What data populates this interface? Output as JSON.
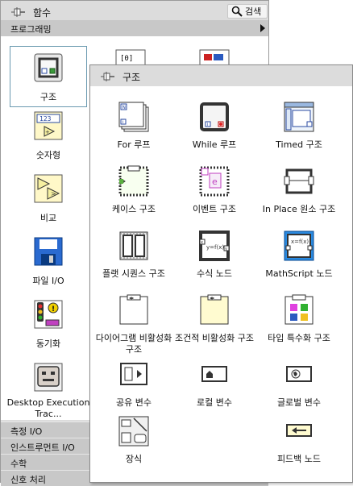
{
  "functions_palette": {
    "title": "함수",
    "search_label": "검색",
    "category_header": "프로그래밍",
    "items": [
      {
        "label": "구조",
        "icon": "structures-icon"
      },
      {
        "label": "숫자형",
        "icon": "numeric-icon"
      },
      {
        "label": "비교",
        "icon": "comparison-icon"
      },
      {
        "label": "파일 I/O",
        "icon": "file-io-icon"
      },
      {
        "label": "동기화",
        "icon": "synchronization-icon"
      },
      {
        "label": "Desktop Execution Trac...",
        "icon": "desktop-execution-trace-icon"
      }
    ],
    "categories": [
      "측정 I/O",
      "인스트루먼트 I/O",
      "수학",
      "신호 처리"
    ]
  },
  "structures_palette": {
    "title": "구조",
    "items": [
      {
        "label": "For 루프",
        "icon": "for-loop-icon"
      },
      {
        "label": "While 루프",
        "icon": "while-loop-icon"
      },
      {
        "label": "Timed 구조",
        "icon": "timed-structure-icon"
      },
      {
        "label": "케이스 구조",
        "icon": "case-structure-icon"
      },
      {
        "label": "이벤트 구조",
        "icon": "event-structure-icon"
      },
      {
        "label": "In Place 원소 구조",
        "icon": "in-place-element-icon"
      },
      {
        "label": "플랫 시퀀스 구조",
        "icon": "flat-sequence-icon"
      },
      {
        "label": "수식 노드",
        "icon": "formula-node-icon"
      },
      {
        "label": "MathScript 노드",
        "icon": "mathscript-node-icon"
      },
      {
        "label": "다이어그램 비활성화 구조",
        "icon": "diagram-disable-icon"
      },
      {
        "label": "조건적 비활성화 구조",
        "icon": "conditional-disable-icon"
      },
      {
        "label": "타입 특수화 구조",
        "icon": "type-specialization-icon"
      },
      {
        "label": "공유 변수",
        "icon": "shared-variable-icon"
      },
      {
        "label": "로컬 변수",
        "icon": "local-variable-icon"
      },
      {
        "label": "글로벌 변수",
        "icon": "global-variable-icon"
      },
      {
        "label": "장식",
        "icon": "decorations-icon"
      },
      {
        "label": "피드백 노드",
        "icon": "feedback-node-icon"
      }
    ]
  },
  "colors": {
    "palette_bg": "#dcdcdc",
    "category_bar": "#c8c8c8",
    "selection_border": "#6a9ab0"
  }
}
